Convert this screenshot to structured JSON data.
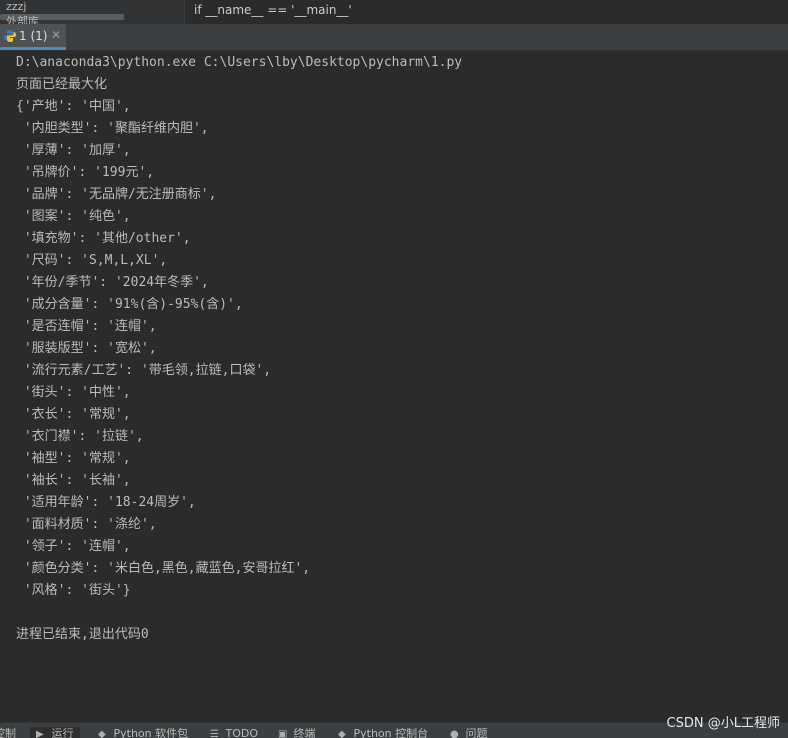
{
  "top_panel": {
    "label1": "zzzj",
    "label2": "外部库"
  },
  "top_code": "if __name__ == '__main__'",
  "run_tab": {
    "label": "1 (1)",
    "close": "✕"
  },
  "console_lines": [
    "D:\\anaconda3\\python.exe C:\\Users\\lby\\Desktop\\pycharm\\1.py",
    "页面已经最大化",
    "{'产地': '中国',",
    " '内胆类型': '聚酯纤维内胆',",
    " '厚薄': '加厚',",
    " '吊牌价': '199元',",
    " '品牌': '无品牌/无注册商标',",
    " '图案': '纯色',",
    " '填充物': '其他/other',",
    " '尺码': 'S,M,L,XL',",
    " '年份/季节': '2024年冬季',",
    " '成分含量': '91%(含)-95%(含)',",
    " '是否连帽': '连帽',",
    " '服装版型': '宽松',",
    " '流行元素/工艺': '带毛领,拉链,口袋',",
    " '街头': '中性',",
    " '衣长': '常规',",
    " '衣门襟': '拉链',",
    " '袖型': '常规',",
    " '袖长': '长袖',",
    " '适用年龄': '18-24周岁',",
    " '面料材质': '涤纶',",
    " '领子': '连帽',",
    " '颜色分类': '米白色,黑色,藏蓝色,安哥拉红',",
    " '风格': '街头'}",
    "",
    "进程已结束,退出代码0"
  ],
  "status_bar": {
    "items": [
      {
        "label": "控制",
        "icon": ""
      },
      {
        "label": "运行",
        "icon": "▶"
      },
      {
        "label": "Python 软件包",
        "icon": "◆"
      },
      {
        "label": "TODO",
        "icon": "☰"
      },
      {
        "label": "终端",
        "icon": "▣"
      },
      {
        "label": "Python 控制台",
        "icon": "◆"
      },
      {
        "label": "问题",
        "icon": "●"
      }
    ]
  },
  "watermark": "CSDN @小L工程师",
  "colors": {
    "background": "#2b2b2b",
    "tab_accent": "#4a88c7",
    "console_text": "#bbbbbb"
  }
}
